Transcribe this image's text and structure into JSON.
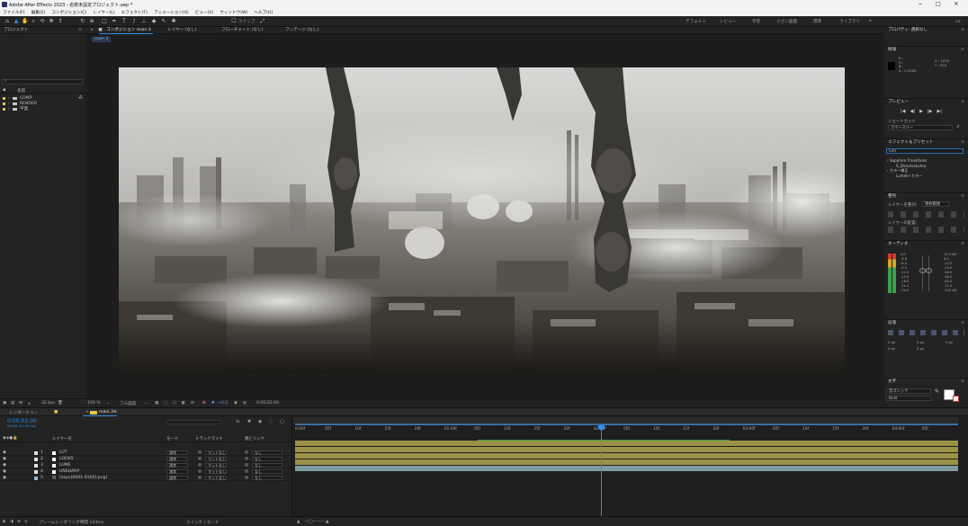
{
  "window": {
    "title": "Adobe After Effects 2023 - 名称未設定プロジェクト.aep *",
    "minimize": "−",
    "maximize": "□",
    "close": "✕"
  },
  "menu": [
    "ファイル(F)",
    "編集(E)",
    "コンポジション(C)",
    "レイヤー(L)",
    "エフェクト(T)",
    "アニメーション(A)",
    "ビュー(V)",
    "ウィンドウ(W)",
    "ヘルプ(H)"
  ],
  "toolbar": {
    "snap_label": "スナップ",
    "workspaces": [
      "デフォルト",
      "レビュー",
      "学習",
      "小さい画面",
      "標準",
      "ライブラリ"
    ],
    "more": "»"
  },
  "project": {
    "title": "プロジェクト",
    "menu": "≡",
    "search_placeholder": "⌕",
    "col_name": "名前",
    "items": [
      {
        "name": "COMP",
        "color": "#e5c84b"
      },
      {
        "name": "RENDER",
        "color": "#e5c84b"
      },
      {
        "name": "平面",
        "color": "#e5c84b"
      }
    ],
    "bpc": "32 bpc"
  },
  "comp_panel": {
    "tab_label": "コンポジション main 3",
    "other_tabs": [
      "レイヤー (なし)",
      "フローチャート (なし)",
      "フッテージ (なし)"
    ],
    "breadcrumb": "main 3",
    "zoom": "100 %",
    "resolution": "フル画質",
    "exposure": "+0.0",
    "timecode": "0:00:02:00"
  },
  "right_panel": {
    "properties_title": "プロパティ: 選択なし",
    "info_title": "情報",
    "info_lines": [
      "R :",
      "G :",
      "B :",
      "A : 0.0000"
    ],
    "info_xy": [
      "X : 1976",
      "Y : 920"
    ],
    "preview_title": "プレビュー",
    "shortcut_label": "ショートカット",
    "shortcut_value": "スペースバー",
    "effects_title": "エフェクト＆プリセット",
    "effects_search": "lum",
    "effects_tree": [
      "› Sapphire Transitions",
      "S_DissolveLuma",
      "› カラー補正",
      "Lumetri カラー"
    ],
    "align_title": "整列",
    "align_label": "レイヤーを整列:",
    "align_target": "選択範囲",
    "distribute_label": "レイヤーの配置:",
    "audio_title": "オーディオ",
    "audio_left": [
      "0.0",
      "-3.0",
      "-6.0",
      "-9.0",
      "-12.0",
      "-15.0",
      "-18.0",
      "-21.0",
      "-24.0"
    ],
    "audio_right": [
      "12.0 dB",
      "0.0",
      "-12.0",
      "-24.0",
      "-36.0",
      "-48.0",
      "-60.0",
      "-72.0",
      "-120 dB"
    ],
    "paragraph_title": "段落",
    "paragraph_fields": [
      "0 px",
      "0 px",
      "0 px",
      "0 px",
      "0 px"
    ],
    "text_title": "文字",
    "font_name": "游ゴシック",
    "font_style": "Bold"
  },
  "timeline": {
    "tabs": [
      "レンダーキュー",
      "main 3"
    ],
    "timecode": "0:00:02:00",
    "frame_info": "00048 (24.00 fps)",
    "cols": {
      "layer_name": "レイヤー名",
      "mode": "モード",
      "track_matte": "トラックマット",
      "parent": "親とリンク"
    },
    "layers": [
      {
        "num": "1",
        "name": "LUT",
        "color": "#e2e2e2",
        "mode": "通常",
        "matte": "マットなし",
        "parent": "なし"
      },
      {
        "num": "2",
        "name": "LOOKS",
        "color": "#e2e2e2",
        "mode": "通常",
        "matte": "マットなし",
        "parent": "なし"
      },
      {
        "num": "3",
        "name": "LUME",
        "color": "#e2e2e2",
        "mode": "通常",
        "matte": "マットなし",
        "parent": "なし"
      },
      {
        "num": "4",
        "name": "UNSHARP",
        "color": "#e2e2e2",
        "mode": "通常",
        "matte": "マットなし",
        "parent": "なし"
      },
      {
        "num": "5",
        "name": "[exps[0001-0100].png]",
        "color": "#8bbdd8",
        "mode": "通常",
        "matte": "マットなし",
        "parent": "なし"
      }
    ],
    "ruler": [
      "0:00f",
      "05f",
      "10f",
      "15f",
      "20f",
      "01:00f",
      "05f",
      "10f",
      "15f",
      "20f",
      "02:00f",
      "05f",
      "10f",
      "15f",
      "20f",
      "03:00f",
      "05f",
      "10f",
      "15f",
      "20f",
      "04:00f",
      "05f"
    ],
    "track_colors": {
      "adjust": "#9b9247",
      "footage": "#7f9aa0"
    }
  },
  "status": {
    "render_time": "フレームレンダリング時間 143ms",
    "switch_mode": "スイッチ / モード"
  }
}
